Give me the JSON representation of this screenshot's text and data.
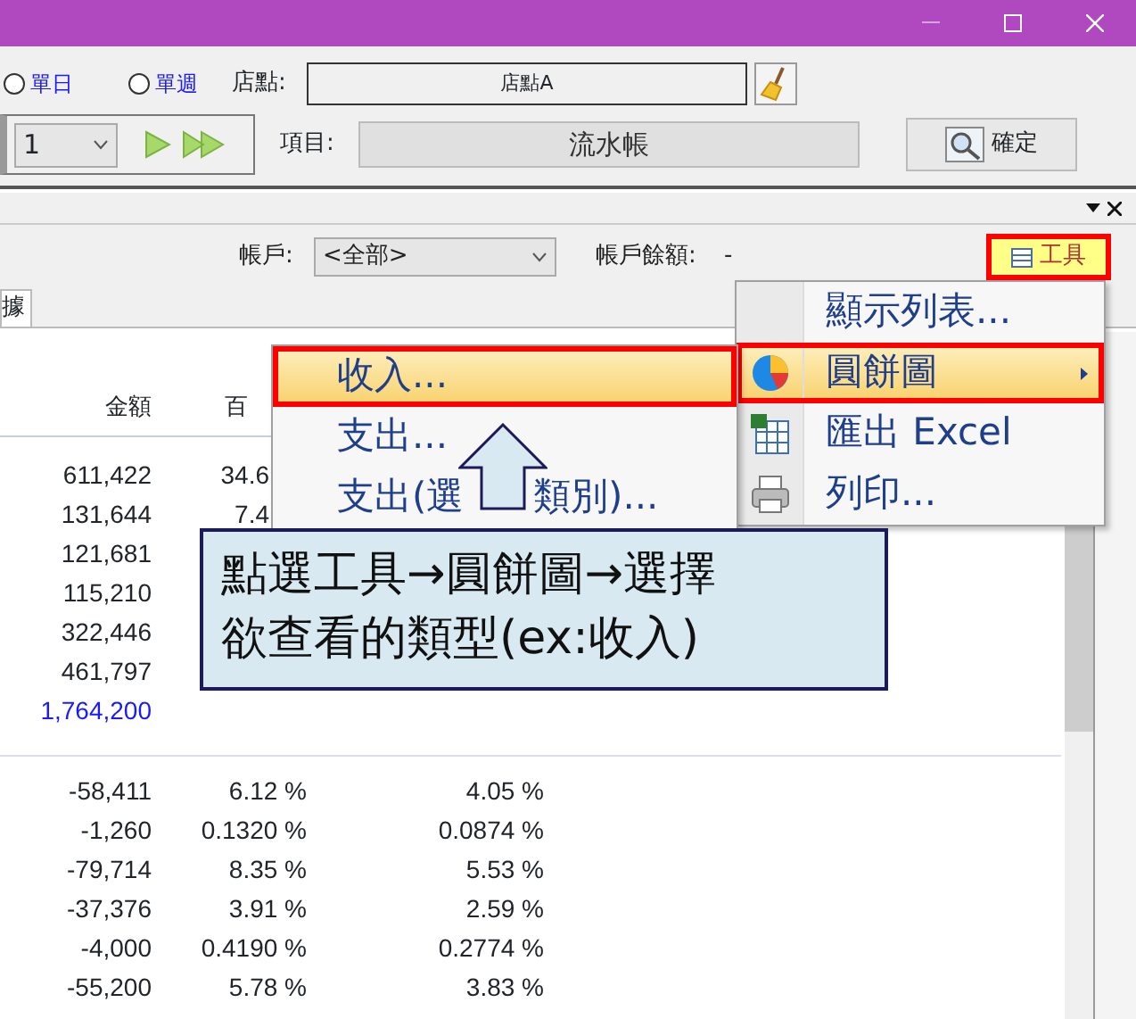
{
  "filters": {
    "radios": [
      {
        "label": "單日",
        "selected": false
      },
      {
        "label": "單週",
        "selected": false
      }
    ],
    "period_select": {
      "value": "1"
    },
    "store": {
      "label": "店點:",
      "value": "店點A"
    },
    "item": {
      "label": "項目:",
      "value": "流水帳"
    },
    "confirm_button": "確定"
  },
  "panel": {
    "account": {
      "label": "帳戶:",
      "value": "<全部>"
    },
    "balance": {
      "label": "帳戶餘額:",
      "value": "-"
    },
    "tools_button": "工具",
    "tab_fragment": "據"
  },
  "table": {
    "columns": [
      "金額",
      "百"
    ],
    "income_rows": [
      {
        "amount": "611,422",
        "share": "34.6"
      },
      {
        "amount": "131,644",
        "share": "7.4"
      },
      {
        "amount": "121,681"
      },
      {
        "amount": "115,210"
      },
      {
        "amount": "322,446"
      },
      {
        "amount": "461,797"
      }
    ],
    "total": "1,764,200",
    "expense_rows": [
      {
        "amount": "-58,411",
        "share": "6.12 %",
        "share_total": "4.05 %"
      },
      {
        "amount": "-1,260",
        "share": "0.1320 %",
        "share_total": "0.0874 %"
      },
      {
        "amount": "-79,714",
        "share": "8.35 %",
        "share_total": "5.53 %"
      },
      {
        "amount": "-37,376",
        "share": "3.91 %",
        "share_total": "2.59 %"
      },
      {
        "amount": "-4,000",
        "share": "0.4190 %",
        "share_total": "0.2774 %"
      },
      {
        "amount": "-55,200",
        "share": "5.78 %",
        "share_total": "3.83 %"
      }
    ]
  },
  "tools_menu": [
    {
      "label": "顯示列表...",
      "kind": "plain",
      "selected": false
    },
    {
      "label": "圓餅圖",
      "kind": "pie",
      "selected": true
    },
    {
      "label": "匯出 Excel",
      "kind": "excel",
      "selected": false
    },
    {
      "label": "列印...",
      "kind": "print",
      "selected": false
    }
  ],
  "submenu": [
    {
      "label": "收入...",
      "selected": true
    },
    {
      "label": "支出...",
      "selected": false
    },
    {
      "label": "支出(選",
      "label_after": "類別)...",
      "selected": false
    }
  ],
  "callout": {
    "lines": [
      "點選工具→圓餅圖→選擇",
      "欲查看的類型(ex:收入)"
    ]
  }
}
